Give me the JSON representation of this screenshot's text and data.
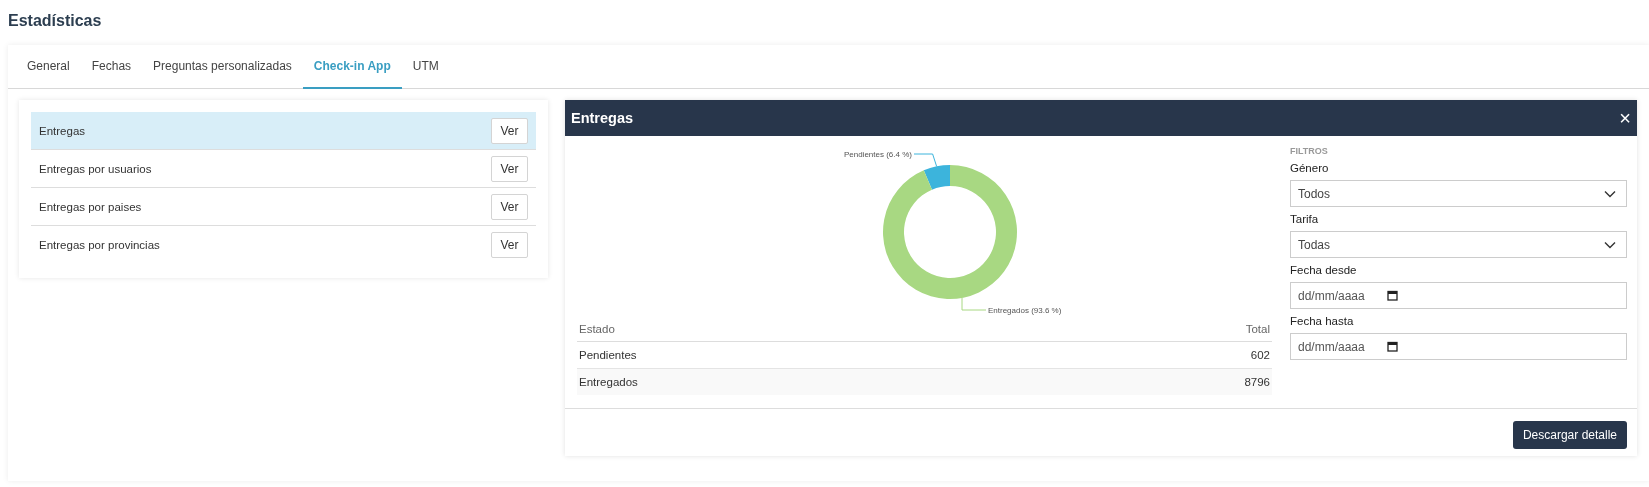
{
  "page_title": "Estadísticas",
  "tabs": [
    {
      "label": "General",
      "selected": false
    },
    {
      "label": "Fechas",
      "selected": false
    },
    {
      "label": "Preguntas personalizadas",
      "selected": false
    },
    {
      "label": "Check-in App",
      "selected": true
    },
    {
      "label": "UTM",
      "selected": false
    }
  ],
  "reports": [
    {
      "label": "Entregas",
      "button": "Ver",
      "selected": true
    },
    {
      "label": "Entregas por usuarios",
      "button": "Ver",
      "selected": false
    },
    {
      "label": "Entregas por paises",
      "button": "Ver",
      "selected": false
    },
    {
      "label": "Entregas por provincias",
      "button": "Ver",
      "selected": false
    }
  ],
  "modal": {
    "title": "Entregas",
    "close": "×",
    "chart_data": {
      "type": "donut",
      "values": [
        6.4,
        93.6
      ],
      "value_labels": [
        "Pendientes (6.4 %)",
        "Entregados (93.6 %)"
      ]
    },
    "table": {
      "columns": [
        "Estado",
        "Total"
      ],
      "rows": [
        [
          "Pendientes",
          "602"
        ],
        [
          "Entregados",
          "8796"
        ]
      ]
    },
    "filters": {
      "heading": "FILTROS",
      "fields": [
        {
          "kind": "select",
          "label": "Género",
          "value": "Todos"
        },
        {
          "kind": "select",
          "label": "Tarifa",
          "value": "Todas"
        },
        {
          "kind": "date",
          "label": "Fecha desde",
          "placeholder": "dd/mm/aaaa"
        },
        {
          "kind": "date",
          "label": "Fecha hasta",
          "placeholder": "dd/mm/aaaa"
        }
      ]
    },
    "download_button": "Descargar detalle"
  }
}
